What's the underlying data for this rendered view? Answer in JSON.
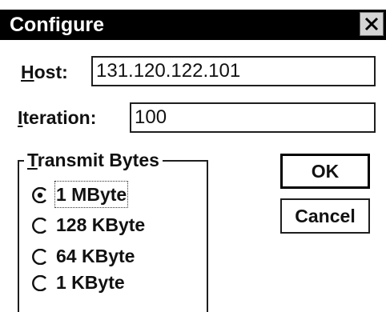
{
  "window": {
    "title": "Configure",
    "close_glyph": "×"
  },
  "form": {
    "host_label_underline": "H",
    "host_label_rest": "ost:",
    "host_value": "131.120.122.101",
    "iteration_label_underline": "I",
    "iteration_label_rest": "teration:",
    "iteration_value": "100"
  },
  "transmit_group": {
    "title_underline": "T",
    "title_rest": "ransmit Bytes",
    "options": [
      {
        "label": "1 MByte",
        "selected": true
      },
      {
        "label": "128 KByte",
        "selected": false
      },
      {
        "label": "64 KByte",
        "selected": false
      },
      {
        "label": "1 KByte",
        "selected": false
      }
    ]
  },
  "buttons": {
    "ok_label": "OK",
    "cancel_label": "Cancel"
  }
}
